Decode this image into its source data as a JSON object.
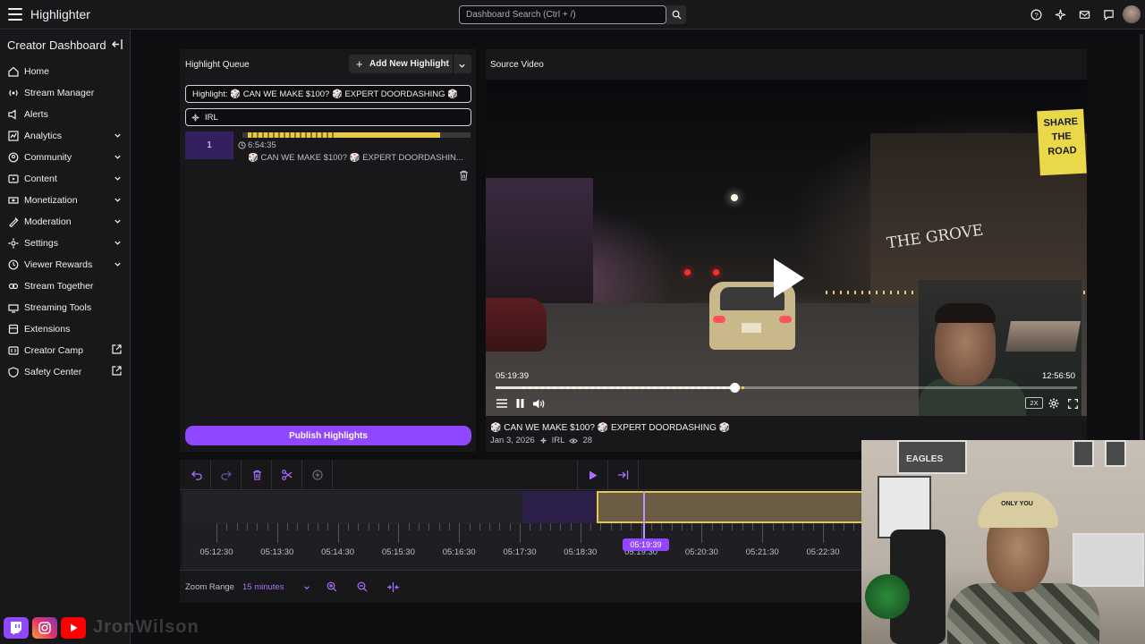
{
  "topbar": {
    "app_title": "Highlighter",
    "search_placeholder": "Dashboard Search (Ctrl + /)",
    "icons": [
      "help-icon",
      "magic-icon",
      "inbox-icon",
      "whispers-icon",
      "avatar"
    ]
  },
  "sidebar": {
    "header": "Creator Dashboard",
    "items": [
      {
        "label": "Home",
        "icon": "home-icon",
        "chevron": false,
        "external": false
      },
      {
        "label": "Stream Manager",
        "icon": "stream-manager-icon",
        "chevron": false,
        "external": false
      },
      {
        "label": "Alerts",
        "icon": "alerts-icon",
        "chevron": false,
        "external": false
      },
      {
        "label": "Analytics",
        "icon": "analytics-icon",
        "chevron": true,
        "external": false
      },
      {
        "label": "Community",
        "icon": "community-icon",
        "chevron": true,
        "external": false
      },
      {
        "label": "Content",
        "icon": "content-icon",
        "chevron": true,
        "external": false
      },
      {
        "label": "Monetization",
        "icon": "monetization-icon",
        "chevron": true,
        "external": false
      },
      {
        "label": "Moderation",
        "icon": "moderation-icon",
        "chevron": true,
        "external": false
      },
      {
        "label": "Settings",
        "icon": "settings-icon",
        "chevron": true,
        "external": false
      },
      {
        "label": "Viewer Rewards",
        "icon": "rewards-icon",
        "chevron": true,
        "external": false
      },
      {
        "label": "Stream Together",
        "icon": "stream-together-icon",
        "chevron": false,
        "external": false
      },
      {
        "label": "Streaming Tools",
        "icon": "streaming-tools-icon",
        "chevron": false,
        "external": false
      },
      {
        "label": "Extensions",
        "icon": "extensions-icon",
        "chevron": false,
        "external": false
      },
      {
        "label": "Creator Camp",
        "icon": "creator-camp-icon",
        "chevron": false,
        "external": true
      },
      {
        "label": "Safety Center",
        "icon": "safety-icon",
        "chevron": false,
        "external": true
      }
    ]
  },
  "queue": {
    "title": "Highlight Queue",
    "add_button": "Add New Highlight",
    "highlight_title_value": "Highlight: 🎲 CAN WE MAKE $100? 🎲 EXPERT DOORDASHING 🎲",
    "category_value": "IRL",
    "clips": [
      {
        "number": "1",
        "duration": "6:54:35",
        "title": "🎲 CAN WE MAKE $100? 🎲 EXPERT DOORDASHIN..."
      }
    ],
    "publish_button": "Publish Highlights"
  },
  "source_video": {
    "title": "Source Video",
    "current_time": "05:19:39",
    "total_time": "12:56:50",
    "progress": 0.41,
    "speed": "2X",
    "sign_text": "SHARE THE ROAD",
    "store_sign": "THE GROVE",
    "stream_title": "🎲 CAN WE MAKE $100? 🎲 EXPERT DOORDASHING 🎲",
    "date": "Jan 3, 2026",
    "category": "IRL",
    "views": "28"
  },
  "timeline": {
    "tools": [
      "undo-icon",
      "redo-icon",
      "delete-icon",
      "scissors-icon",
      "add-icon",
      "play-icon",
      "jump-end-icon"
    ],
    "tick_labels": [
      "05:12:30",
      "05:13:30",
      "05:14:30",
      "05:15:30",
      "05:16:30",
      "05:17:30",
      "05:18:30",
      "05:19:30",
      "05:20:30",
      "05:21:30",
      "05:22:30"
    ],
    "playhead_time": "05:19:39",
    "zoom_label": "Zoom Range",
    "zoom_value": "15 minutes"
  },
  "webcam": {
    "cap_text": "ONLY YOU",
    "poster_text": "EAGLES"
  },
  "socials": {
    "handle": "JronWilson",
    "icons": [
      "twitch-icon",
      "instagram-icon",
      "youtube-icon"
    ],
    "colors": {
      "twitch": "#9147ff",
      "instagram": "#e1306c",
      "youtube": "#ff0000"
    }
  },
  "colors": {
    "accent": "#9147ff",
    "clip_yellow": "#e8c84a",
    "background": "#0e0e10",
    "panel": "#18181b"
  }
}
